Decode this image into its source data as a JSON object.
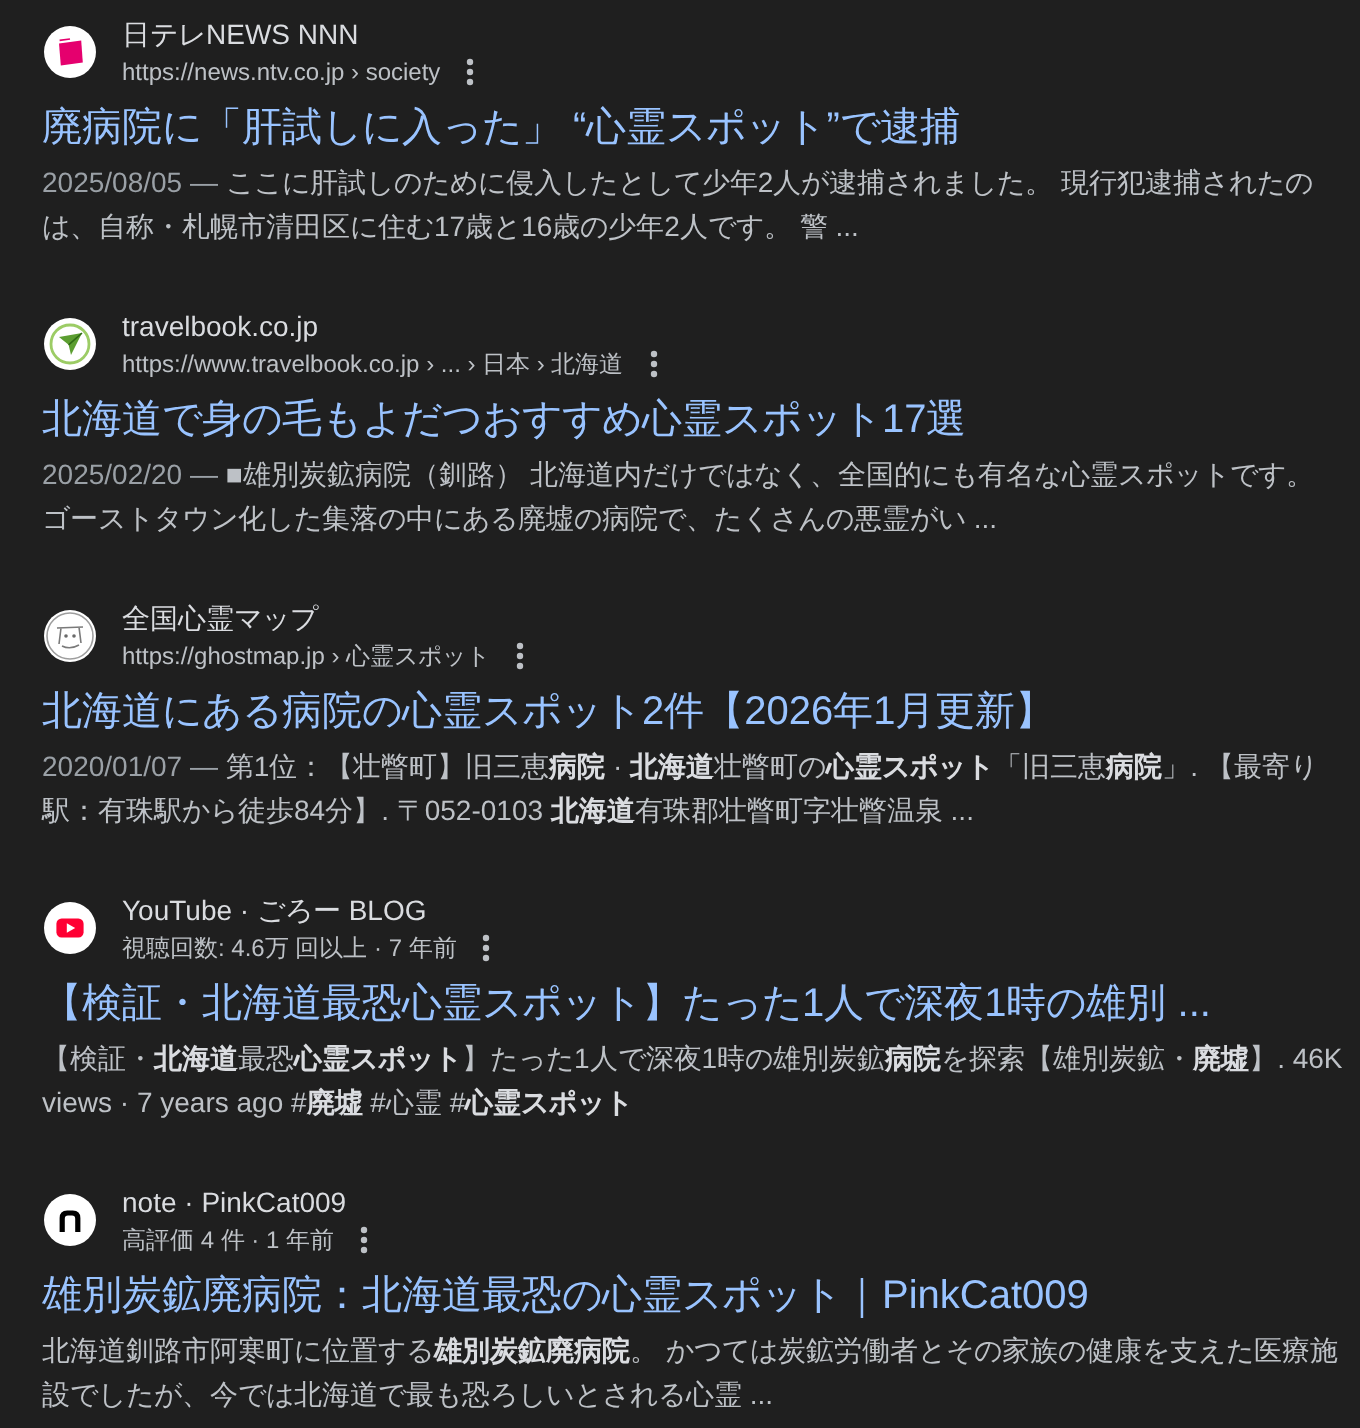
{
  "results": [
    {
      "kind": "tile",
      "site": "日テレNEWS NNN",
      "url": "https://news.ntv.co.jp › society",
      "title": "廃病院に「肝試しに入った」 “心霊スポット”で逮捕",
      "date": "2025/08/05 —",
      "snippet": "ここに肝試しのために侵入したとして少年2人が逮捕されました。 現行犯逮捕されたのは、自称・札幌市清田区に住む17歳と16歳の少年2人です。 警 ..."
    },
    {
      "kind": "plane",
      "site": "travelbook.co.jp",
      "url": "https://www.travelbook.co.jp › ... › 日本 › 北海道",
      "title": "北海道で身の毛もよだつおすすめ心霊スポット17選",
      "date": "2025/02/20 —",
      "snippet": "■雄別炭鉱病院（釧路） 北海道内だけではなく、全国的にも有名な心霊スポットです。ゴーストタウン化した集落の中にある廃墟の病院で、たくさんの悪霊がい ..."
    },
    {
      "kind": "sketch",
      "site": "全国心霊マップ",
      "url": "https://ghostmap.jp › 心霊スポット",
      "title": "北海道にある病院の心霊スポット2件【2026年1月更新】",
      "date": "2020/01/07 —",
      "snippet": "第1位：【壮瞥町】旧三恵**病院** · **北海道**壮瞥町の**心霊スポット**「旧三恵**病院**」. 【最寄り駅：有珠駅から徒歩84分】. 〒052-0103 **北海道**有珠郡壮瞥町字壮瞥温泉 ..."
    },
    {
      "kind": "play",
      "site": "YouTube · ごろー BLOG",
      "meta": "視聴回数: 4.6万 回以上 · 7 年前",
      "title": "【検証・北海道最恐心霊スポット】たった1人で深夜1時の雄別 ...",
      "snippet": "【検証・**北海道**最恐**心霊スポット**】たった1人で深夜1時の雄別炭鉱**病院**を探索【雄別炭鉱・**廃墟**】. 46K views · 7 years ago #**廃墟** #心霊 #**心霊スポット**"
    },
    {
      "kind": "arch",
      "site": "note · PinkCat009",
      "meta": "高評価 4 件 · 1 年前",
      "title": "雄別炭鉱廃病院：北海道最恐の心霊スポット｜PinkCat009",
      "snippet": "北海道釧路市阿寒町に位置する**雄別炭鉱廃病院**。 かつては炭鉱労働者とその家族の健康を支えた医療施設でしたが、今では北海道で最も恐ろしいとされる心霊 ..."
    }
  ]
}
